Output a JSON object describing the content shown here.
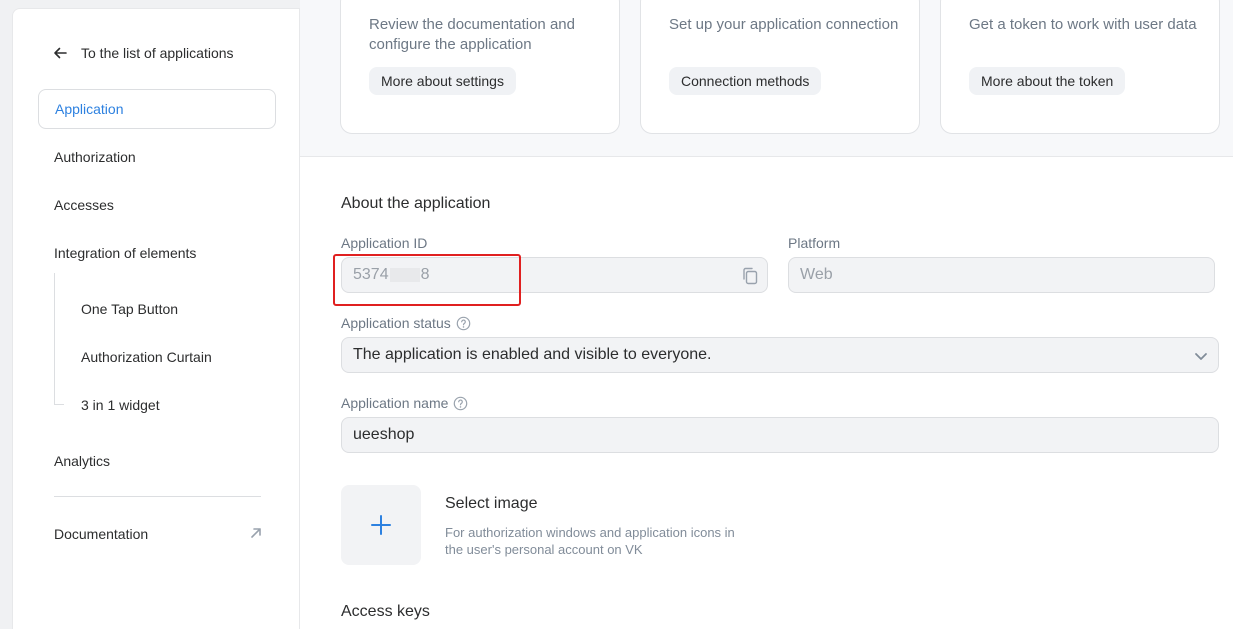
{
  "sidebar": {
    "back_label": "To the list of applications",
    "items": [
      {
        "label": "Application"
      },
      {
        "label": "Authorization"
      },
      {
        "label": "Accesses"
      },
      {
        "label": "Integration of elements"
      }
    ],
    "sub_items": [
      {
        "label": "One Tap Button"
      },
      {
        "label": "Authorization Curtain"
      },
      {
        "label": "3 in 1 widget"
      }
    ],
    "analytics_label": "Analytics",
    "documentation_label": "Documentation"
  },
  "cards": [
    {
      "text": "Review the documentation and configure the application",
      "button": "More about settings"
    },
    {
      "text": "Set up your application connection",
      "button": "Connection methods"
    },
    {
      "text": "Get a token to work with user data",
      "button": "More about the token"
    }
  ],
  "about": {
    "title": "About the application",
    "app_id_label": "Application ID",
    "app_id_prefix": "5374",
    "app_id_suffix": "8",
    "platform_label": "Platform",
    "platform_value": "Web",
    "status_label": "Application status",
    "status_value": "The application is enabled and visible to everyone.",
    "name_label": "Application name",
    "name_value": "ueeshop",
    "image_title": "Select image",
    "image_desc": "For authorization windows and application icons in the user's personal account on VK"
  },
  "access_keys_title": "Access keys",
  "colors": {
    "accent": "#2d81e0",
    "highlight": "#e02020"
  }
}
